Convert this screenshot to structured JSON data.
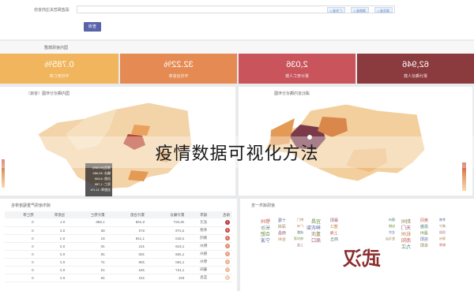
{
  "overlay_title": "疫情数据可视化方法",
  "search": {
    "title": "请选择您关注的省份",
    "tags": [
      "湖北省 ×",
      "湖南省 ×",
      "广东省 ×"
    ],
    "query_label": "查询"
  },
  "stats": {
    "title": "国内疫情数据",
    "cards": [
      {
        "value": "62,946",
        "label": "累计确诊人数",
        "color": "#8b3a3d"
      },
      {
        "value": "2,036",
        "label": "累计死亡人数",
        "color": "#c9545b"
      },
      {
        "value": "32.22%",
        "label": "平均治愈率",
        "color": "#e58a52"
      },
      {
        "value": "0.785%",
        "label": "平均死亡率",
        "color": "#f1b55d"
      }
    ]
  },
  "map_left": {
    "title": "湖北省内确诊分布图"
  },
  "map_right": {
    "title": "国内确诊分布图（省级）",
    "tooltip": [
      "湖北(59,989)",
      "确诊: 59,989",
      "治愈: 6,639",
      "死亡: 1,789",
      "治愈率: 11.1%"
    ]
  },
  "word_cloud": {
    "title": "疫情城市一览",
    "big_word": "武汉",
    "words": [
      "孝感",
      "黄冈",
      "荆州",
      "随州",
      "襄阳",
      "宜昌",
      "荆门",
      "十堰",
      "鄂州",
      "咸宁",
      "恩施",
      "天门",
      "仙桃",
      "潜江",
      "神农架",
      "广州",
      "深圳",
      "长沙",
      "岳阳",
      "温州",
      "杭州",
      "北京",
      "上海",
      "重庆",
      "成都",
      "南昌",
      "合肥",
      "郑州",
      "信阳",
      "南阳",
      "驻马店",
      "商丘",
      "周口",
      "哈尔滨",
      "台州",
      "宁波",
      "蚌埠",
      "阜阳",
      "九江",
      "上饶"
    ]
  },
  "table": {
    "title": "城市疫情严重程度排名",
    "columns": [
      "排名",
      "城市",
      "累计确诊",
      "累计治愈",
      "累计死亡",
      "治愈率",
      "死亡率"
    ],
    "rows": [
      [
        "1",
        "武汉",
        "45,027",
        "5,448",
        "1,586",
        "0.1",
        "0"
      ],
      [
        "2",
        "孝感",
        "3,279",
        "674",
        "65",
        "0.2",
        "0"
      ],
      [
        "3",
        "黄冈",
        "2,823",
        "1,149",
        "81",
        "0.4",
        "0"
      ],
      [
        "4",
        "荆州",
        "1,519",
        "431",
        "40",
        "0.3",
        "0"
      ],
      [
        "5",
        "随州",
        "1,268",
        "330",
        "28",
        "0.3",
        "0"
      ],
      [
        "6",
        "鄂州",
        "1,260",
        "208",
        "37",
        "0.2",
        "0"
      ],
      [
        "7",
        "襄阳",
        "1,167",
        "264",
        "23",
        "0.2",
        "0"
      ],
      [
        "8",
        "宜昌",
        "931",
        "231",
        "26",
        "0.2",
        "0"
      ]
    ],
    "rank_colors": [
      "#b83a3a",
      "#c84c4c",
      "#d96a5a",
      "#e08a6a",
      "#e89b7b",
      "#f0ad8d",
      "#f0b89a",
      "#f3c7ae"
    ]
  }
}
